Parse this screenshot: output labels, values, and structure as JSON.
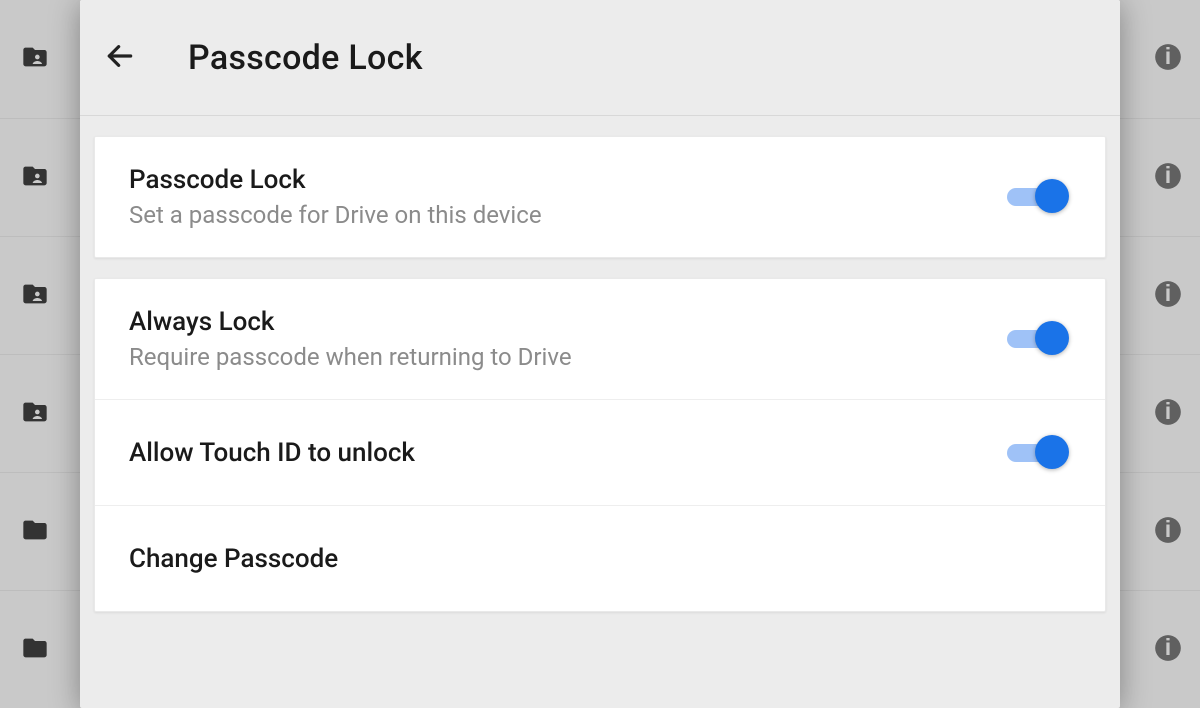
{
  "header": {
    "title": "Passcode Lock"
  },
  "section1": {
    "passcode_lock": {
      "title": "Passcode Lock",
      "subtitle": "Set a passcode for Drive on this device",
      "on": true
    }
  },
  "section2": {
    "always_lock": {
      "title": "Always Lock",
      "subtitle": "Require passcode when returning to Drive",
      "on": true
    },
    "touch_id": {
      "title": "Allow Touch ID to unlock",
      "on": true
    },
    "change_passcode": {
      "title": "Change Passcode"
    }
  },
  "icons": {
    "back": "arrow-left-icon",
    "folder_shared": "folder-shared-icon",
    "folder": "folder-icon",
    "info": "info-icon"
  },
  "colors": {
    "accent": "#1a73e8",
    "accent_track": "#9fc2f7"
  }
}
